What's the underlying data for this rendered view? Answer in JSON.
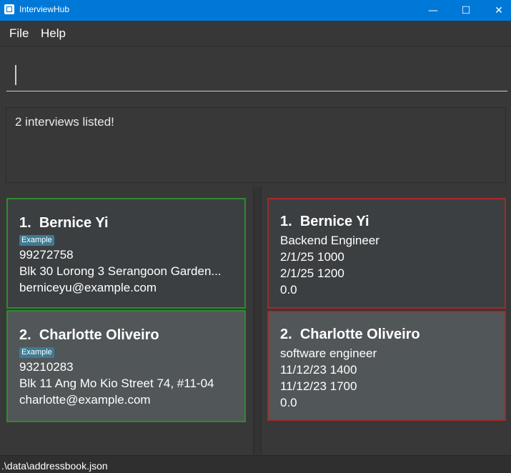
{
  "window": {
    "title": "InterviewHub",
    "controls": {
      "minimize": "—",
      "maximize": "☐",
      "close": "✕"
    }
  },
  "menu": {
    "items": [
      "File",
      "Help"
    ]
  },
  "command": {
    "value": "",
    "placeholder": ""
  },
  "result": {
    "message": "2 interviews listed!"
  },
  "persons": [
    {
      "index": "1.",
      "name": "Bernice Yi",
      "tag": "Example",
      "phone": "99272758",
      "address": "Blk 30 Lorong 3 Serangoon Garden...",
      "email": "berniceyu@example.com"
    },
    {
      "index": "2.",
      "name": "Charlotte Oliveiro",
      "tag": "Example",
      "phone": "93210283",
      "address": "Blk 11 Ang Mo Kio Street 74, #11-04",
      "email": "charlotte@example.com"
    }
  ],
  "interviews": [
    {
      "index": "1.",
      "name": "Bernice Yi",
      "role": "Backend Engineer",
      "start": "2/1/25 1000",
      "end": "2/1/25 1200",
      "rating": "0.0"
    },
    {
      "index": "2.",
      "name": "Charlotte Oliveiro",
      "role": "software engineer",
      "start": "11/12/23 1400",
      "end": "11/12/23 1700",
      "rating": "0.0"
    }
  ],
  "status": {
    "path": ".\\data\\addressbook.json"
  },
  "colors": {
    "titlebar": "#0078d7",
    "person_border": "#2e8b2e",
    "interview_border": "#a22a2a",
    "tag_bg": "#3e7b91"
  }
}
